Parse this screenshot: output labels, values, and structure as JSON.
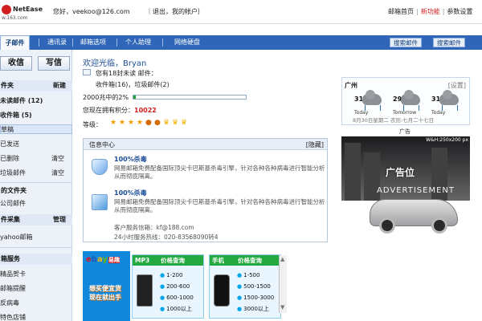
{
  "header": {
    "logo": {
      "brand": "NetEase",
      "site": "w.163.com"
    },
    "greeting": "您好，veekoo@126.com",
    "logout": "｜退出，我的帐户｝",
    "links": [
      "邮箱首页",
      "新功能",
      "参数设置"
    ],
    "accent_color": "#d21f1f"
  },
  "nav": {
    "tabs": [
      "子邮件",
      "通讯录",
      "邮箱选项",
      "个人助理",
      "网络硬盘"
    ],
    "search_buttons": [
      "搜索邮件",
      "搜索邮件"
    ]
  },
  "sidebar": {
    "buttons": [
      "收信",
      "写信"
    ],
    "mail_folder_title": "件夹",
    "new_label": "新建",
    "items": [
      {
        "label": "未读邮件 (12)",
        "bold": true
      },
      {
        "label": "收件箱 (5)",
        "bold": true
      },
      {
        "label": "草稿",
        "selected": true
      },
      {
        "label": "已发送"
      },
      {
        "label": "已删除",
        "action": "清空"
      },
      {
        "label": "垃圾邮件",
        "action": "清空"
      }
    ],
    "my_folders_title": "的文件夹",
    "company_mail": "公司邮件",
    "external_title": "件采集",
    "manage_label": "管理",
    "yahoo_mail": "yahoo邮箱",
    "services_title": "箱服务",
    "services": [
      "精品贺卡",
      "邮箱提醒",
      "反病毒",
      "特色店铺"
    ]
  },
  "welcome": {
    "hello": "欢迎光临，Bryan",
    "new_mail": "您有18封未读 邮件：",
    "folders": "收件箱(16)，垃圾邮件(2)",
    "storage_label": "2000兆中的2%",
    "storage_used": 0.02,
    "points_label": "您现在拥有积分：",
    "points": "10022",
    "level_label": "等级："
  },
  "info_center": {
    "title": "信息中心",
    "hide": "[隐藏]",
    "items": [
      {
        "title": "100%杀毒",
        "text": "网易邮箱免费配备国际顶尖卡巴斯基杀毒引擎，针对各种各种病毒进行智能分析从而彻底隔离。"
      },
      {
        "title": "100%杀毒",
        "text": "网易邮箱免费配备国际顶尖卡巴斯基杀毒引擎，针对各种各种病毒进行智能分析从而彻底隔离。"
      }
    ],
    "service_email": "客户服务信箱：kf@188.com",
    "service_phone": "24小时服务热线：020-83568090转4"
  },
  "weather": {
    "city": "广州",
    "settings": "[设置]",
    "days": [
      {
        "temp": "31°",
        "label": "Today"
      },
      {
        "temp": "29°",
        "label": "Tomorrow"
      },
      {
        "temp": "31°",
        "label": "Today"
      }
    ],
    "date": "8月30日星期二 农历:七月二十七日"
  },
  "ad": {
    "title": "广告",
    "size": "W&H:250x200 px",
    "headline": "广告位",
    "subtitle": "ADVERTISEMENT"
  },
  "promos": {
    "ebay": [
      "e",
      "b",
      "a",
      "y"
    ],
    "ebay_cn": "易趣",
    "slogan_lines": [
      "想买便宜货",
      "现在就出手"
    ],
    "mp3_title": "MP3",
    "mp3_query": "价格查询",
    "mp3_prices": [
      "1-200",
      "200-600",
      "600-1000",
      "1000以上"
    ],
    "phone_title": "手机",
    "phone_query": "价格查询",
    "phone_prices": [
      "1-500",
      "500-1500",
      "1500-3000",
      "3000以上"
    ],
    "promo_color": "#23a93f"
  }
}
